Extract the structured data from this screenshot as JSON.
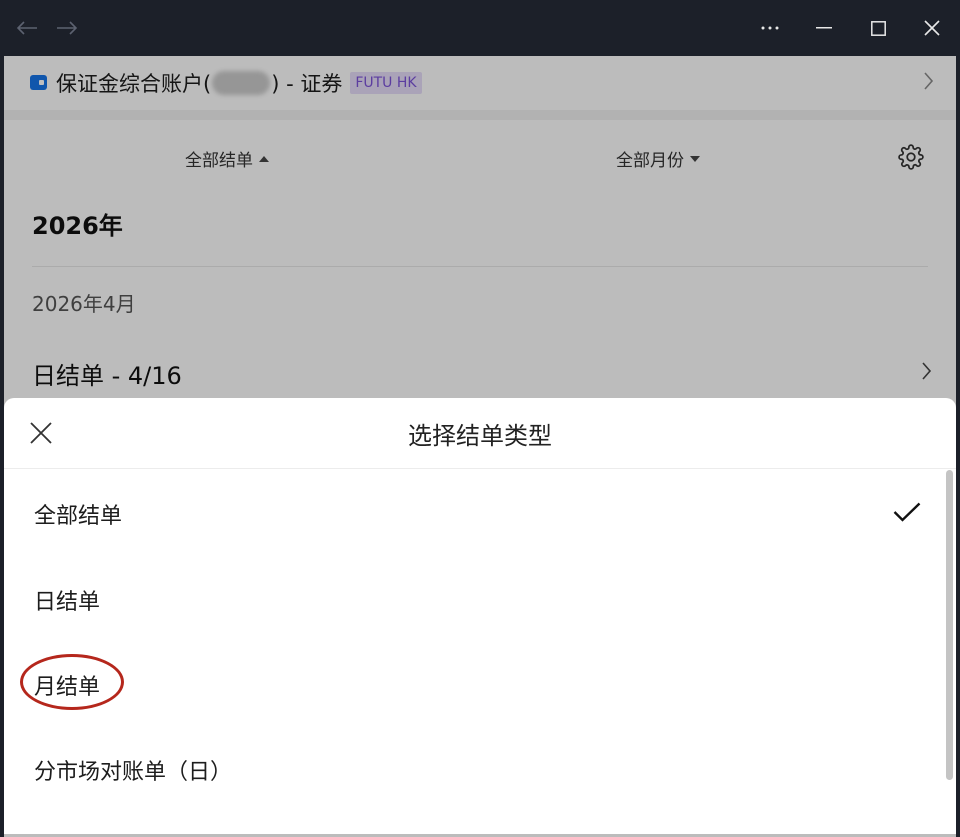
{
  "window": {
    "nav_back_glyph": "←",
    "nav_forward_glyph": "→",
    "more_glyph": "···"
  },
  "account": {
    "title_prefix": "保证金综合账户(",
    "title_suffix": ") - 证券",
    "broker_badge": "FUTU HK",
    "colors": {
      "wallet_icon": "#1673e6",
      "badge_bg": "#e3daf6",
      "badge_text": "#7b52d6"
    }
  },
  "filters": {
    "statement_type": "全部结单",
    "month": "全部月份"
  },
  "statements": {
    "year": "2026年",
    "month": "2026年4月",
    "row_label": "日结单 - 4/16"
  },
  "sheet": {
    "title": "选择结单类型",
    "options": [
      {
        "label": "全部结单",
        "selected": true
      },
      {
        "label": "日结单",
        "selected": false
      },
      {
        "label": "月结单",
        "selected": false,
        "highlighted": true
      },
      {
        "label": "分市场对账单（日）",
        "selected": false
      }
    ],
    "highlight_color": "#b5271c"
  }
}
